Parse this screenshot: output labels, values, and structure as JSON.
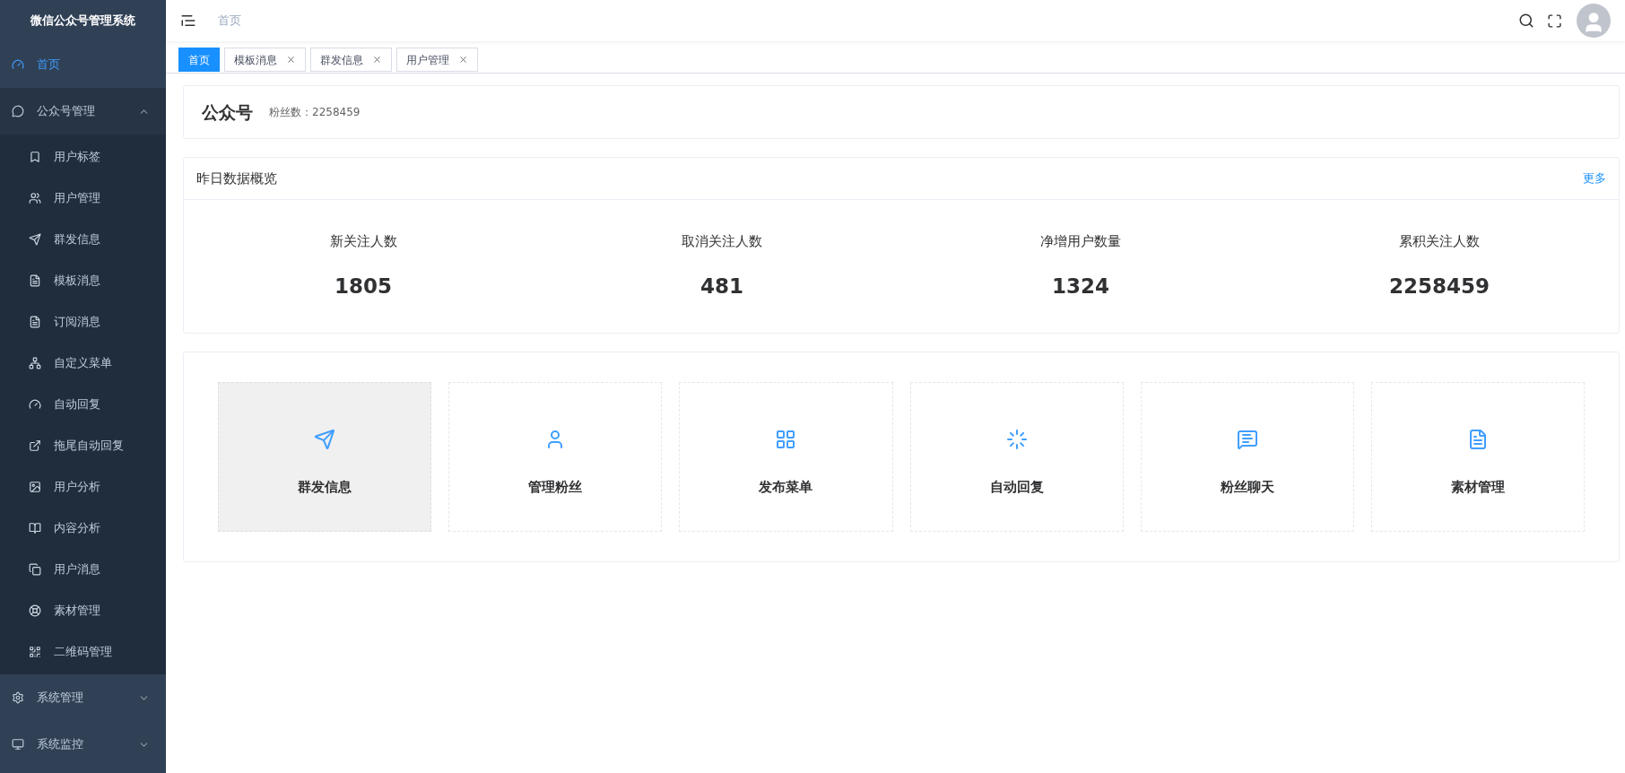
{
  "sidebar": {
    "title": "微信公众号管理系统",
    "items": [
      {
        "label": "首页",
        "selected": true,
        "kind": "link"
      },
      {
        "label": "公众号管理",
        "selected": false,
        "kind": "group",
        "expanded": true,
        "children": [
          {
            "label": "用户标签",
            "selected": false
          },
          {
            "label": "用户管理",
            "selected": false
          },
          {
            "label": "群发信息",
            "selected": false
          },
          {
            "label": "模板消息",
            "selected": false
          },
          {
            "label": "订阅消息",
            "selected": false
          },
          {
            "label": "自定义菜单",
            "selected": false
          },
          {
            "label": "自动回复",
            "selected": false
          },
          {
            "label": "拖尾自动回复",
            "selected": false
          },
          {
            "label": "用户分析",
            "selected": false
          },
          {
            "label": "内容分析",
            "selected": false
          },
          {
            "label": "用户消息",
            "selected": false
          },
          {
            "label": "素材管理",
            "selected": false
          },
          {
            "label": "二维码管理",
            "selected": false
          }
        ]
      },
      {
        "label": "系统管理",
        "selected": false,
        "kind": "group",
        "expanded": false
      },
      {
        "label": "系统监控",
        "selected": false,
        "kind": "group",
        "expanded": false
      }
    ]
  },
  "header": {
    "breadcrumb": "首页"
  },
  "tabs": [
    {
      "label": "首页",
      "selected": true,
      "closable": false
    },
    {
      "label": "模板消息",
      "selected": false,
      "closable": true
    },
    {
      "label": "群发信息",
      "selected": false,
      "closable": true
    },
    {
      "label": "用户管理",
      "selected": false,
      "closable": true
    }
  ],
  "account": {
    "title": "公众号",
    "fans_label": "粉丝数：",
    "fans": "2258459"
  },
  "overview": {
    "title": "昨日数据概览",
    "more": "更多",
    "stats": [
      {
        "label": "新关注人数",
        "value": "1805"
      },
      {
        "label": "取消关注人数",
        "value": "481"
      },
      {
        "label": "净增用户数量",
        "value": "1324"
      },
      {
        "label": "累积关注人数",
        "value": "2258459"
      }
    ]
  },
  "shortcuts": [
    {
      "label": "群发信息",
      "selected": true
    },
    {
      "label": "管理粉丝",
      "selected": false
    },
    {
      "label": "发布菜单",
      "selected": false
    },
    {
      "label": "自动回复",
      "selected": false
    },
    {
      "label": "粉丝聊天",
      "selected": false
    },
    {
      "label": "素材管理",
      "selected": false
    }
  ]
}
